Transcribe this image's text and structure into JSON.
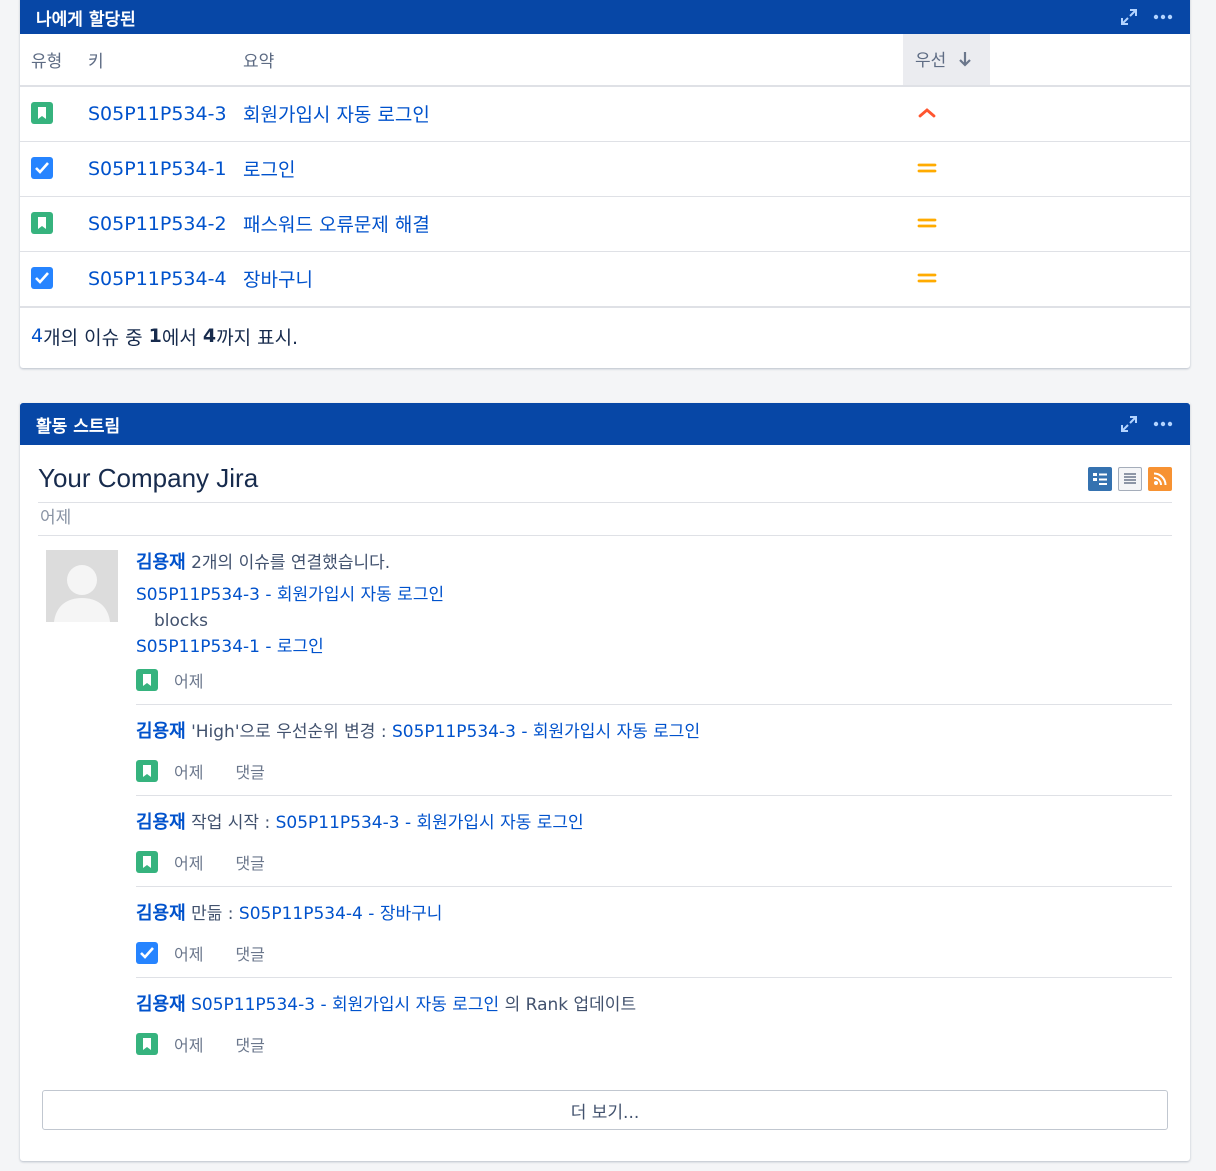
{
  "assigned": {
    "title": "나에게 할당된",
    "columns": {
      "type": "유형",
      "key": "키",
      "summary": "요약",
      "priority": "우선"
    },
    "issues": [
      {
        "type": "story",
        "key": "S05P11P534-3",
        "summary": "회원가입시 자동 로그인",
        "priority": "high"
      },
      {
        "type": "task",
        "key": "S05P11P534-1",
        "summary": "로그인",
        "priority": "medium"
      },
      {
        "type": "story",
        "key": "S05P11P534-2",
        "summary": "패스워드 오류문제 해결",
        "priority": "medium"
      },
      {
        "type": "task",
        "key": "S05P11P534-4",
        "summary": "장바구니",
        "priority": "medium"
      }
    ],
    "footer": {
      "total": "4",
      "t1": "개의 이슈 중 ",
      "from": "1",
      "t2": "에서 ",
      "to": "4",
      "t3": "까지 표시."
    }
  },
  "stream": {
    "title": "활동 스트림",
    "heading": "Your Company Jira",
    "date_label": "어제",
    "user": "김용재",
    "comment_label": "댓글",
    "more_label": "더 보기...",
    "entries": [
      {
        "action": " 2개의 이슈를 연결했습니다.",
        "link1": "S05P11P534-3 - 회원가입시 자동 로그인",
        "relation": "blocks",
        "link2": "S05P11P534-1 - 로그인",
        "type": "story",
        "time": "어제"
      },
      {
        "action": " 'High'으로 우선순위 변경 : ",
        "link1": "S05P11P534-3 - 회원가입시 자동 로그인",
        "type": "story",
        "time": "어제"
      },
      {
        "action": " 작업 시작 : ",
        "link1": "S05P11P534-3 - 회원가입시 자동 로그인",
        "type": "story",
        "time": "어제"
      },
      {
        "action": " 만듦 : ",
        "link1": "S05P11P534-4 - 장바구니",
        "type": "task",
        "time": "어제"
      },
      {
        "link1": "S05P11P534-3 - 회원가입시 자동 로그인",
        "suffix": " 의 Rank 업데이트",
        "type": "story",
        "time": "어제"
      }
    ]
  },
  "colors": {
    "header": "#0747a6",
    "link": "#0052cc",
    "story": "#36b37e",
    "task": "#2684ff",
    "prio_high": "#ff5630",
    "prio_medium": "#ffab00"
  }
}
